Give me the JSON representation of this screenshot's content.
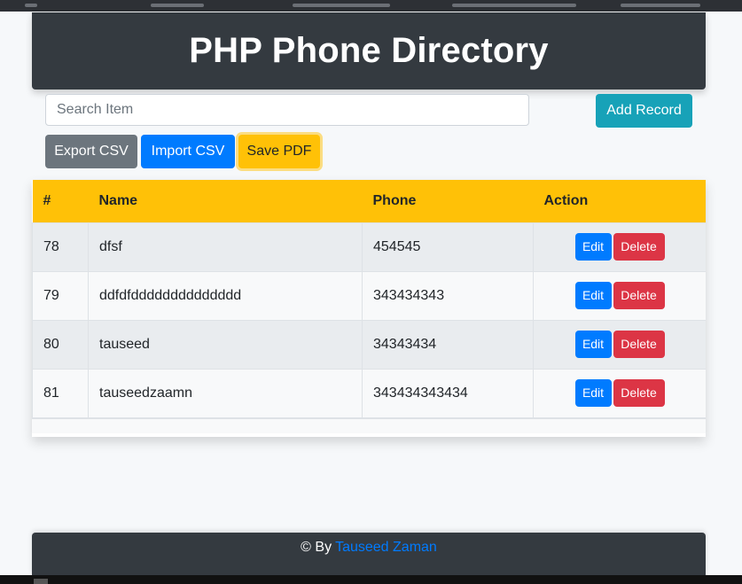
{
  "header": {
    "title": "PHP Phone Directory"
  },
  "search": {
    "placeholder": "Search Item"
  },
  "toolbar": {
    "add_label": "Add Record",
    "export_label": "Export CSV",
    "import_label": "Import CSV",
    "pdf_label": "Save PDF"
  },
  "table": {
    "columns": [
      "#",
      "Name",
      "Phone",
      "Action"
    ],
    "rows": [
      {
        "id": "78",
        "name": "dfsf",
        "phone": "454545",
        "edit": "Edit",
        "delete": "Delete"
      },
      {
        "id": "79",
        "name": "ddfdfdddddddddddddd",
        "phone": "343434343",
        "edit": "Edit",
        "delete": "Delete"
      },
      {
        "id": "80",
        "name": "tauseed",
        "phone": "34343434",
        "edit": "Edit",
        "delete": "Delete"
      },
      {
        "id": "81",
        "name": "tauseedzaamn",
        "phone": "343434343434",
        "edit": "Edit",
        "delete": "Delete"
      }
    ]
  },
  "footer": {
    "prefix": "© By",
    "author": "Tauseed Zaman"
  },
  "colors": {
    "header_bg": "#343a40",
    "table_head_bg": "#ffc107",
    "add_btn": "#17a2b8",
    "export_btn": "#6c757d",
    "import_btn": "#007bff",
    "pdf_btn": "#ffc107",
    "edit_btn": "#007bff",
    "delete_btn": "#dc3545",
    "link": "#007bff"
  }
}
